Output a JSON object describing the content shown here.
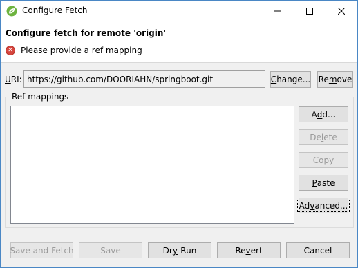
{
  "window": {
    "title": "Configure Fetch",
    "controls": {
      "minimize": "—",
      "maximize": "☐",
      "close": "✕"
    }
  },
  "header": {
    "title": "Configure fetch for remote 'origin'",
    "message": "Please provide a ref mapping",
    "message_icon": "error-icon",
    "error_color": "#d6463f"
  },
  "uri": {
    "label_mnemonic": "U",
    "label_rest": "RI:",
    "value": "https://github.com/DOORIAHN/springboot.git",
    "change_button": {
      "pre": "",
      "mn": "C",
      "post": "hange..."
    },
    "remove_button": {
      "pre": "Re",
      "mn": "m",
      "post": "ove"
    }
  },
  "ref_mappings": {
    "group_label": "Ref mappings",
    "items": [],
    "buttons": {
      "add": {
        "pre": "A",
        "mn": "d",
        "post": "d..."
      },
      "delete": {
        "pre": "De",
        "mn": "l",
        "post": "ete"
      },
      "copy": {
        "pre": "C",
        "mn": "o",
        "post": "py"
      },
      "paste": {
        "pre": "",
        "mn": "P",
        "post": "aste"
      },
      "advanced": {
        "pre": "Ad",
        "mn": "v",
        "post": "anced..."
      }
    }
  },
  "footer": {
    "save_and_fetch": "Save and Fetch",
    "save": "Save",
    "dry_run": {
      "pre": "Dr",
      "mn": "y",
      "post": "-Run"
    },
    "revert": {
      "pre": "Re",
      "mn": "v",
      "post": "ert"
    },
    "cancel": "Cancel"
  },
  "colors": {
    "window_border": "#4a87c5",
    "dialog_bg": "#f0f0f0",
    "focus_border": "#0078d7"
  }
}
